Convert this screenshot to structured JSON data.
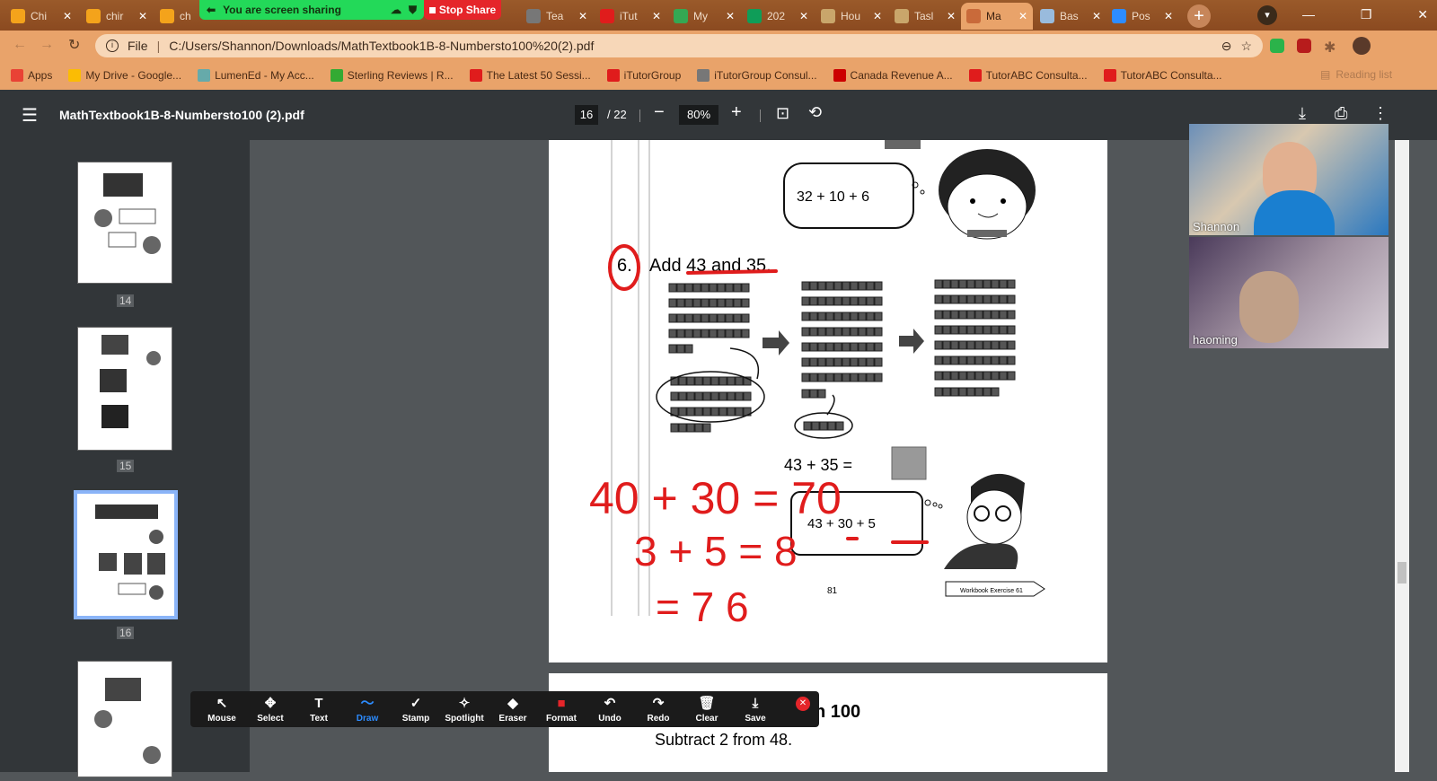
{
  "tabs": [
    {
      "label": "Chi",
      "fav": "#f4a31b"
    },
    {
      "label": "chir",
      "fav": "#f4a31b"
    },
    {
      "label": "ch",
      "fav": "#f4a31b"
    },
    {
      "label": "Tea",
      "fav": "#777"
    },
    {
      "label": "iTut",
      "fav": "#e01c1c"
    },
    {
      "label": "My",
      "fav": "#34a853"
    },
    {
      "label": "202",
      "fav": "#0f9d58"
    },
    {
      "label": "Hou",
      "fav": "#c9a66b"
    },
    {
      "label": "Tasl",
      "fav": "#c9a66b"
    },
    {
      "label": "Ma",
      "fav": "#c96a3a"
    },
    {
      "label": "Bas",
      "fav": "#9bd"
    },
    {
      "label": "Pos",
      "fav": "#2d8cff"
    }
  ],
  "share": {
    "status": "You are screen sharing",
    "stop": "Stop Share"
  },
  "address": {
    "scheme": "File",
    "url": "C:/Users/Shannon/Downloads/MathTextbook1B-8-Numbersto100%20(2).pdf"
  },
  "bookmarks": [
    "Apps",
    "My Drive - Google...",
    "LumenEd - My Acc...",
    "Sterling Reviews | R...",
    "The Latest 50 Sessi...",
    "iTutorGroup",
    "iTutorGroup Consul...",
    "Canada Revenue A...",
    "TutorABC Consulta...",
    "TutorABC Consulta..."
  ],
  "reading_list": "Reading list",
  "pdf": {
    "title": "MathTextbook1B-8-Numbersto100 (2).pdf",
    "page": "16",
    "total": "/ 22",
    "zoom": "80%"
  },
  "thumbs": [
    {
      "label": "14"
    },
    {
      "label": "15"
    },
    {
      "label": "16"
    }
  ],
  "doc": {
    "bubble1": "32  +  10  +  6",
    "q_num": "6.",
    "q_text": "Add 43 and 35.",
    "equation": "43  +  35  =",
    "bubble2": "43  +  30  +  5",
    "page_no": "81",
    "workbook": "Workbook Exercise 61",
    "hand1": "40 + 30 = 70",
    "hand2": "3 + 5 = 8",
    "hand3": "= 7 6",
    "next_title": "n 100",
    "next_text": "Subtract 2 from 48."
  },
  "toolbar": [
    {
      "label": "Mouse",
      "icon": "↖"
    },
    {
      "label": "Select",
      "icon": "✥"
    },
    {
      "label": "Text",
      "icon": "T"
    },
    {
      "label": "Draw",
      "icon": "〜"
    },
    {
      "label": "Stamp",
      "icon": "✓"
    },
    {
      "label": "Spotlight",
      "icon": "✧"
    },
    {
      "label": "Eraser",
      "icon": "◆"
    },
    {
      "label": "Format",
      "icon": "■"
    },
    {
      "label": "Undo",
      "icon": "↶"
    },
    {
      "label": "Redo",
      "icon": "↷"
    },
    {
      "label": "Clear",
      "icon": "🗑"
    },
    {
      "label": "Save",
      "icon": "⤓"
    }
  ],
  "videos": [
    {
      "name": "Shannon"
    },
    {
      "name": "haoming"
    }
  ],
  "colors": {
    "share_green": "#23d959",
    "stop_red": "#e5252a",
    "draw_blue": "#2d8cff",
    "ink_red": "#e01c1c"
  }
}
